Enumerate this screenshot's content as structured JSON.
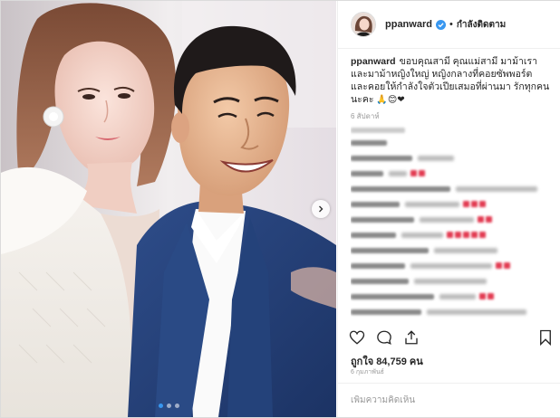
{
  "post": {
    "username": "ppanward",
    "follow_label": "กำลังติดตาม",
    "separator": "•",
    "caption_username": "ppanward",
    "caption_text": "ขอบคุณสามี คุณแม่สามี มาม้าเรา และมาม้าหญิงใหญ่ หญิงกลางที่คอยซัพพอร์ต และคอยให้กำลังใจตัวเปียเสมอที่ผ่านมา รักทุกคนนะคะ",
    "caption_emojis": "🙏😊❤",
    "caption_time": "6 สัปดาห์",
    "likes_text": "ถูกใจ 84,759 คน",
    "date_text": "6 กุมภาพันธ์",
    "comment_placeholder": "เพิ่มความคิดเห็น"
  },
  "colors": {
    "accent": "#3897f0",
    "verified": "#3897f0",
    "heart": "#ed4956"
  },
  "icons": [
    "verified-badge-icon",
    "heart-icon",
    "comment-icon",
    "share-icon",
    "bookmark-icon",
    "chevron-right-icon"
  ],
  "carousel": {
    "slides": 3,
    "active_slide": 1
  }
}
